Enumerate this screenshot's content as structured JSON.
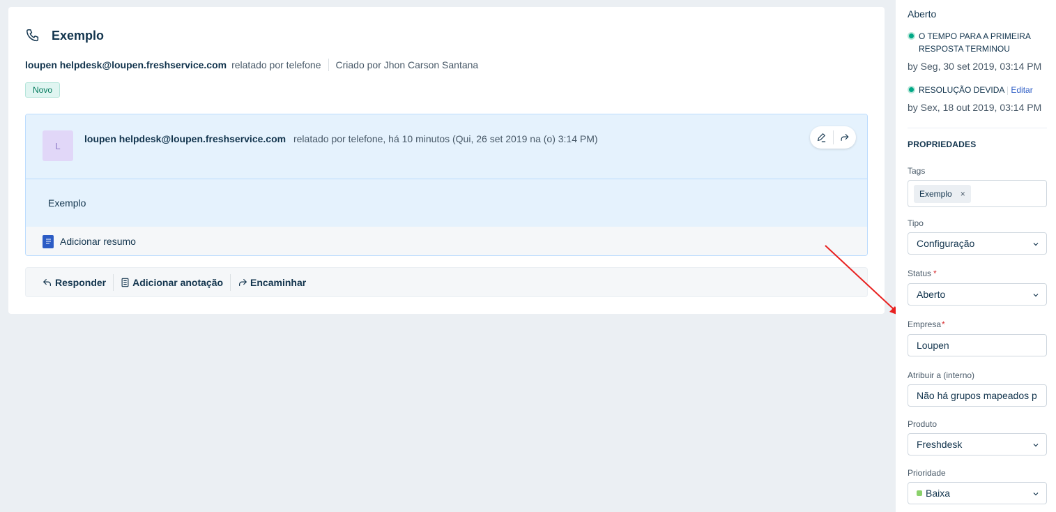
{
  "ticket": {
    "title": "Exemplo",
    "requester": "loupen helpdesk@loupen.freshservice.com",
    "source_text": "relatado por telefone",
    "created_by": "Criado por Jhon Carson Santana",
    "status_badge": "Novo"
  },
  "conversation": {
    "avatar_initial": "L",
    "requester": "loupen helpdesk@loupen.freshservice.com",
    "meta": "relatado por telefone, há 10 minutos (Qui, 26 set 2019 na (o) 3:14 PM)",
    "body": "Exemplo",
    "summary_label": "Adicionar resumo"
  },
  "reply_bar": {
    "reply": "Responder",
    "note": "Adicionar anotação",
    "forward": "Encaminhar"
  },
  "sidebar": {
    "status": "Aberto",
    "sla_first_response": {
      "label": "O TEMPO PARA A PRIMEIRA RESPOSTA TERMINOU",
      "by": "by Seg, 30 set 2019, 03:14 PM"
    },
    "sla_resolution": {
      "label": "RESOLUÇÃO DEVIDA",
      "edit": "Editar",
      "by": "by Sex, 18 out 2019, 03:14 PM"
    },
    "properties_title": "PROPRIEDADES",
    "fields": {
      "tags_label": "Tags",
      "tag_value": "Exemplo",
      "tag_remove": "×",
      "tipo_label": "Tipo",
      "tipo_value": "Configuração",
      "status_label": "Status",
      "status_value": "Aberto",
      "empresa_label": "Empresa",
      "empresa_value": "Loupen",
      "atribuir_label": "Atribuir a (interno)",
      "atribuir_value": "Não há grupos mapeados p",
      "produto_label": "Produto",
      "produto_value": "Freshdesk",
      "prioridade_label": "Prioridade",
      "prioridade_value": "Baixa",
      "required_mark": "*"
    }
  },
  "colors": {
    "accent": "#2c5cc5",
    "sla_green": "#00a886",
    "badge_green": "#00795b",
    "priority_low": "#8bd16b",
    "annotation_arrow": "#e8201f"
  }
}
